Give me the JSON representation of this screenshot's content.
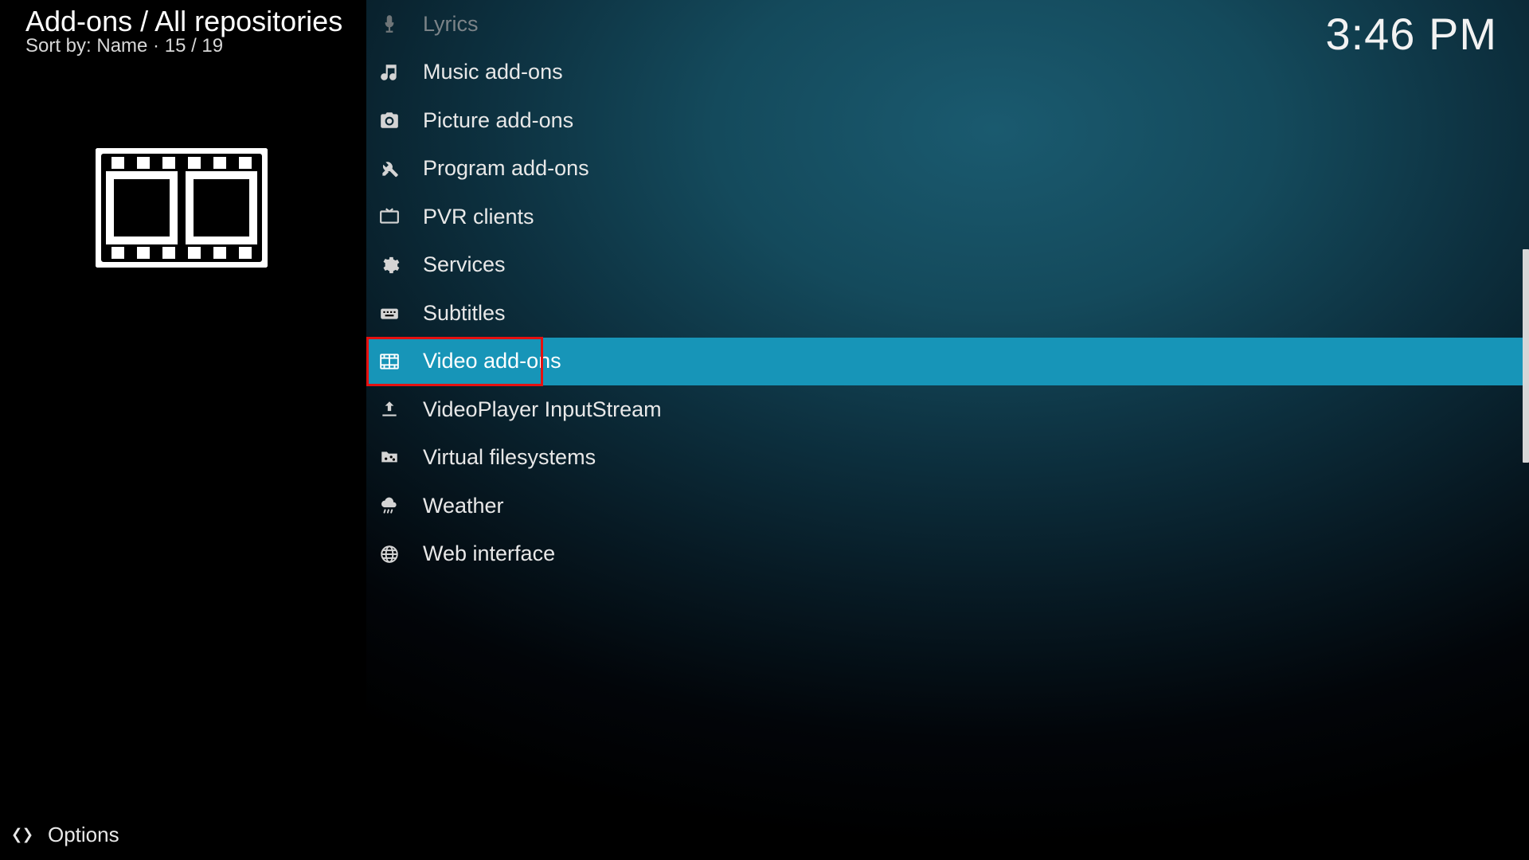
{
  "header": {
    "breadcrumb": "Add-ons / All repositories",
    "sort_line": "Sort by: Name  ·  15 / 19",
    "clock": "3:46 PM"
  },
  "category_preview": {
    "icon": "film-icon"
  },
  "list": {
    "items": [
      {
        "icon": "microphone-icon",
        "label": "Lyrics",
        "faded": true,
        "selected": false
      },
      {
        "icon": "music-note-icon",
        "label": "Music add-ons",
        "faded": false,
        "selected": false
      },
      {
        "icon": "camera-icon",
        "label": "Picture add-ons",
        "faded": false,
        "selected": false
      },
      {
        "icon": "tools-icon",
        "label": "Program add-ons",
        "faded": false,
        "selected": false
      },
      {
        "icon": "tv-icon",
        "label": "PVR clients",
        "faded": false,
        "selected": false
      },
      {
        "icon": "gear-icon",
        "label": "Services",
        "faded": false,
        "selected": false
      },
      {
        "icon": "keyboard-icon",
        "label": "Subtitles",
        "faded": false,
        "selected": false
      },
      {
        "icon": "film-icon",
        "label": "Video add-ons",
        "faded": false,
        "selected": true
      },
      {
        "icon": "upload-icon",
        "label": "VideoPlayer InputStream",
        "faded": false,
        "selected": false
      },
      {
        "icon": "folder-network-icon",
        "label": "Virtual filesystems",
        "faded": false,
        "selected": false
      },
      {
        "icon": "weather-icon",
        "label": "Weather",
        "faded": false,
        "selected": false
      },
      {
        "icon": "globe-icon",
        "label": "Web interface",
        "faded": false,
        "selected": false
      }
    ]
  },
  "footer": {
    "options_label": "Options"
  }
}
